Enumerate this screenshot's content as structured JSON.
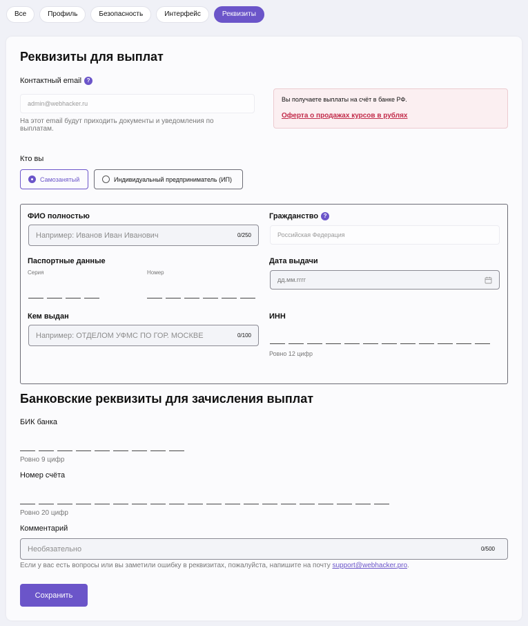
{
  "tabs": [
    "Все",
    "Профиль",
    "Безопасность",
    "Интерфейс",
    "Реквизиты"
  ],
  "active_tab": "Реквизиты",
  "page_title": "Реквизиты для выплат",
  "email": {
    "label": "Контактный email",
    "value": "admin@webhacker.ru",
    "hint": "На этот email будут приходить документы и уведомления по выплатам."
  },
  "notice": {
    "text": "Вы получаете выплаты на счёт в банке РФ.",
    "link": "Оферта о продажах курсов в рублях"
  },
  "who": {
    "label": "Кто вы",
    "options": [
      "Самозанятый",
      "Индивидуальный предприниматель (ИП)"
    ],
    "selected": "Самозанятый"
  },
  "person": {
    "fio_label": "ФИО полностью",
    "fio_placeholder": "Например: Иванов Иван Иванович",
    "fio_counter": "0/250",
    "citizenship_label": "Гражданство",
    "citizenship_value": "Российская Федерация",
    "passport_label": "Паспортные данные",
    "series_label": "Серия",
    "series_digits": 4,
    "number_label": "Номер",
    "number_digits": 6,
    "issue_date_label": "Дата выдачи",
    "issue_date_placeholder": "дд.мм.гггг",
    "issued_by_label": "Кем выдан",
    "issued_by_placeholder": "Например: ОТДЕЛОМ УФМС ПО ГОР. МОСКВЕ",
    "issued_by_counter": "0/100",
    "inn_label": "ИНН",
    "inn_digits": 12,
    "inn_hint": "Ровно 12 цифр"
  },
  "bank": {
    "title": "Банковские реквизиты для зачисления выплат",
    "bik_label": "БИК банка",
    "bik_digits": 9,
    "bik_hint": "Ровно 9 цифр",
    "account_label": "Номер счёта",
    "account_digits": 20,
    "account_hint": "Ровно 20 цифр",
    "comment_label": "Комментарий",
    "comment_placeholder": "Необязательно",
    "comment_counter": "0/500",
    "support_text": "Если у вас есть вопросы или вы заметили ошибку в реквизитах, пожалуйста, напишите на почту",
    "support_email": "support@webhacker.pro",
    "support_end": "."
  },
  "save_label": "Сохранить",
  "colors": {
    "accent": "#6b55c9",
    "notice_link": "#c22b4a",
    "notice_bg": "#fbeff1"
  }
}
